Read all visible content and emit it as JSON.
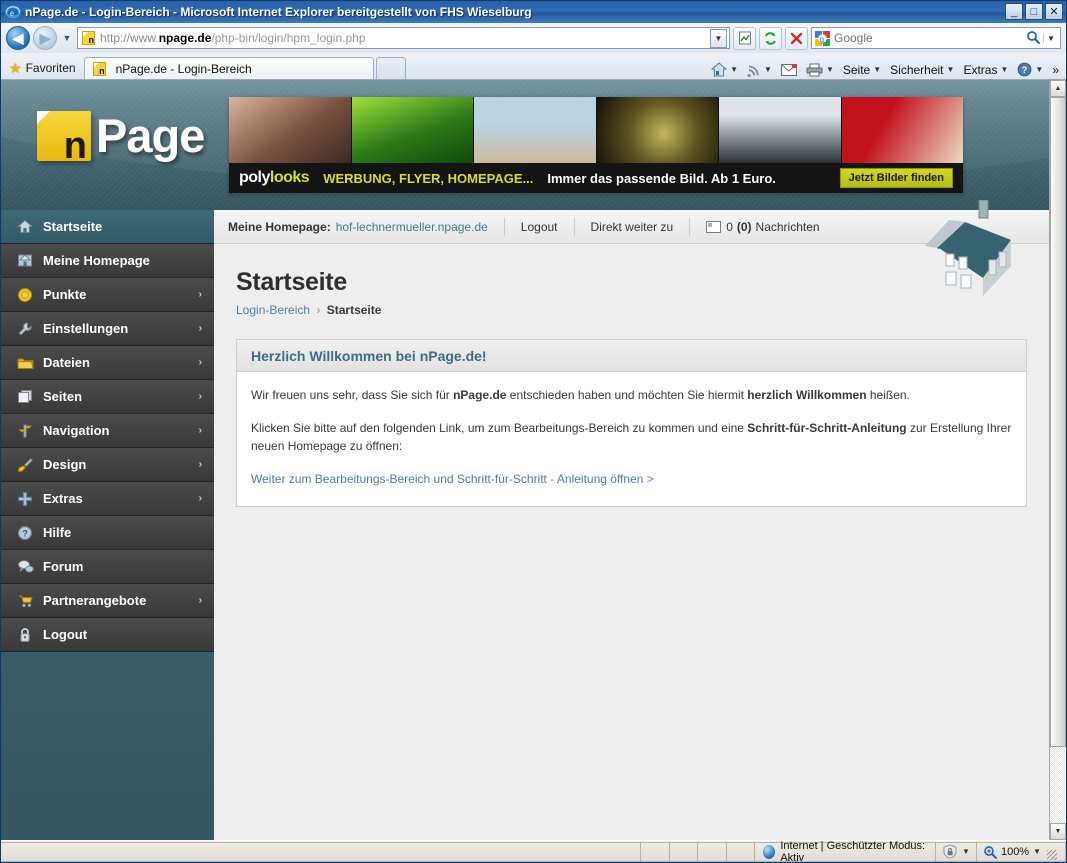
{
  "browser": {
    "title": "nPage.de - Login-Bereich - Microsoft Internet Explorer bereitgestellt von FHS Wieselburg",
    "window_buttons": {
      "minimize": "_",
      "maximize": "□",
      "close": "✕"
    },
    "nav": {
      "back": "◀",
      "forward": "▶",
      "history_caret": "▼"
    },
    "address": {
      "scheme": "http://www.",
      "host": "npage.de",
      "path": "/php-bin/login/hpm_login.php",
      "favicon_letter": "n",
      "dropdown_caret": "▼"
    },
    "toolbar_icons": [
      {
        "name": "compatibility-view-icon",
        "glyph": "▧"
      },
      {
        "name": "refresh-icon",
        "glyph": "↻"
      },
      {
        "name": "stop-icon",
        "glyph": "✕"
      }
    ],
    "search": {
      "engine": "Google",
      "placeholder": "Google",
      "value": "",
      "go_glyph": "🔍",
      "caret": "▼"
    },
    "favorites_label": "Favoriten",
    "tab_label": "nPage.de - Login-Bereich",
    "command_bar": [
      {
        "label": "",
        "icon": "home-icon",
        "caret": "▼"
      },
      {
        "label": "",
        "icon": "feeds-icon",
        "caret": "▼"
      },
      {
        "label": "",
        "icon": "mail-icon",
        "caret": ""
      },
      {
        "label": "",
        "icon": "print-icon",
        "caret": "▼"
      },
      {
        "label": "Seite",
        "icon": "",
        "caret": "▼"
      },
      {
        "label": "Sicherheit",
        "icon": "",
        "caret": "▼"
      },
      {
        "label": "Extras",
        "icon": "",
        "caret": "▼"
      },
      {
        "label": "",
        "icon": "help-icon",
        "caret": "▼"
      },
      {
        "label": "»",
        "icon": "",
        "caret": ""
      }
    ],
    "status": {
      "zone": "Internet | Geschützter Modus: Aktiv",
      "zoom": "100%",
      "zoom_caret": "▼",
      "protected_caret": "▼"
    }
  },
  "site": {
    "logo": {
      "mark_letter": "n",
      "word": "Page"
    },
    "banner": {
      "brand_white": "poly",
      "brand_yellow": "looks",
      "claim_yellow": "WERBUNG, FLYER, HOMEPAGE...",
      "claim_white": "Immer das passende Bild. Ab 1 Euro.",
      "button": "Jetzt Bilder finden",
      "images": [
        {
          "name": "woman-on-bed-photo",
          "c1": "#c9a18c",
          "c2": "#6e4a3c"
        },
        {
          "name": "forest-photo",
          "c1": "#8fd12e",
          "c2": "#1d5c12"
        },
        {
          "name": "family-beach-photo",
          "c1": "#bcd3e2",
          "c2": "#c7b79c"
        },
        {
          "name": "crocodile-photo",
          "c1": "#b8ad55",
          "c2": "#14120a"
        },
        {
          "name": "business-people-photo",
          "c1": "#cfd6dd",
          "c2": "#2b3036"
        },
        {
          "name": "blonde-woman-red-photo",
          "c1": "#e8d9c8",
          "c2": "#b5111b"
        }
      ]
    },
    "sidebar": [
      {
        "label": "Startseite",
        "icon": "house-icon",
        "glyph": "🏠",
        "arrow": "",
        "active": true
      },
      {
        "label": "Meine Homepage",
        "icon": "homepage-icon",
        "glyph": "🏡",
        "arrow": "",
        "active": false
      },
      {
        "label": "Punkte",
        "icon": "coin-icon",
        "glyph": "🪙",
        "arrow": "›",
        "active": false
      },
      {
        "label": "Einstellungen",
        "icon": "wrench-icon",
        "glyph": "🔧",
        "arrow": "›",
        "active": false
      },
      {
        "label": "Dateien",
        "icon": "folder-icon",
        "glyph": "📁",
        "arrow": "›",
        "active": false
      },
      {
        "label": "Seiten",
        "icon": "pages-icon",
        "glyph": "🗔",
        "arrow": "›",
        "active": false
      },
      {
        "label": "Navigation",
        "icon": "signpost-icon",
        "glyph": "🪧",
        "arrow": "›",
        "active": false
      },
      {
        "label": "Design",
        "icon": "brush-icon",
        "glyph": "🖌",
        "arrow": "›",
        "active": false
      },
      {
        "label": "Extras",
        "icon": "plus-icon",
        "glyph": "✚",
        "arrow": "›",
        "active": false
      },
      {
        "label": "Hilfe",
        "icon": "question-icon",
        "glyph": "?",
        "arrow": "",
        "active": false
      },
      {
        "label": "Forum",
        "icon": "speech-icon",
        "glyph": "💬",
        "arrow": "",
        "active": false
      },
      {
        "label": "Partnerangebote",
        "icon": "cart-icon",
        "glyph": "🛒",
        "arrow": "›",
        "active": false
      },
      {
        "label": "Logout",
        "icon": "lock-icon",
        "glyph": "🔒",
        "arrow": "",
        "active": false
      }
    ],
    "topbar": {
      "homepage_label": "Meine Homepage:",
      "homepage_url": "hof-lechnermueller.npage.de",
      "logout": "Logout",
      "direkt": "Direkt weiter zu",
      "messages_count": "0",
      "messages_unread": "(0)",
      "messages_label": "Nachrichten"
    },
    "page_title": "Startseite",
    "breadcrumb": {
      "root": "Login-Bereich",
      "sep": "›",
      "current": "Startseite"
    },
    "panel": {
      "heading": "Herzlich Willkommen bei nPage.de!",
      "p1_a": "Wir freuen uns sehr, dass Sie sich für ",
      "p1_b": "nPage.de",
      "p1_c": " entschieden haben und möchten Sie hiermit ",
      "p1_d": "herzlich Willkommen",
      "p1_e": " heißen.",
      "p2_a": "Klicken Sie bitte auf den folgenden Link, um zum Bearbeitungs-Bereich zu kommen und eine ",
      "p2_b": "Schritt-für-Schritt-Anleitung",
      "p2_c": " zur Erstellung Ihrer neuen Homepage zu öffnen:",
      "link": "Weiter zum Bearbeitungs-Bereich und Schritt-für-Schritt - Anleitung öffnen >"
    },
    "colors": {
      "accent_teal": "#3d6d84",
      "link": "#4a7fa5",
      "banner_yellow": "#d9dd27"
    }
  }
}
